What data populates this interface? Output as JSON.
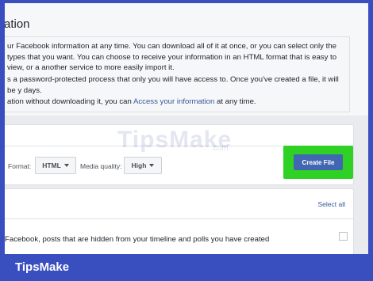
{
  "page": {
    "title": "ation",
    "paragraphs": [
      "ur Facebook information at any time. You can download all of it at once, or you can select only the types that you want. You can choose to receive your information in an HTML format that is easy to view, or a another service to more easily import it.",
      "s a password-protected process that only you will have access to. Once you've created a file, it will be y days."
    ],
    "access_prefix": "ation without downloading it, you can ",
    "access_link": "Access your information",
    "access_suffix": " at any time."
  },
  "options": {
    "format_label": "Format:",
    "format_value": "HTML",
    "media_label": "Media quality:",
    "media_value": "High",
    "create_button": "Create File"
  },
  "list": {
    "select_all": "Select all",
    "row_text": "Facebook, posts that are hidden from your timeline and polls you have created"
  },
  "watermark": {
    "text": "TipsMake",
    "suffix": ".com"
  },
  "footer": {
    "brand": "TipsMake"
  },
  "colors": {
    "brand_border": "#3a4fbf",
    "button_blue": "#4267b2",
    "highlight_green": "#2fd124",
    "link": "#365899"
  }
}
